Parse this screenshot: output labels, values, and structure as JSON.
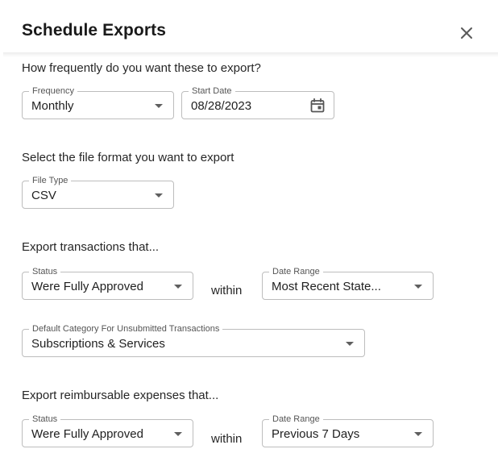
{
  "header": {
    "title": "Schedule Exports",
    "close_icon": "close-icon"
  },
  "frequency_section": {
    "prompt": "How frequently do you want these to export?",
    "frequency": {
      "label": "Frequency",
      "value": "Monthly"
    },
    "start_date": {
      "label": "Start Date",
      "value": "08/28/2023",
      "icon": "calendar-icon"
    }
  },
  "format_section": {
    "prompt": "Select the file format you want to export",
    "file_type": {
      "label": "File Type",
      "value": "CSV"
    }
  },
  "transactions_section": {
    "prompt": "Export transactions that...",
    "status": {
      "label": "Status",
      "value": "Were Fully Approved"
    },
    "within_text": "within",
    "date_range": {
      "label": "Date Range",
      "value": "Most Recent State..."
    },
    "default_category": {
      "label": "Default Category For Unsubmitted Transactions",
      "value": "Subscriptions & Services"
    }
  },
  "reimbursable_section": {
    "prompt": "Export reimbursable expenses that...",
    "status": {
      "label": "Status",
      "value": "Were Fully Approved"
    },
    "within_text": "within",
    "date_range": {
      "label": "Date Range",
      "value": "Previous 7 Days"
    }
  }
}
